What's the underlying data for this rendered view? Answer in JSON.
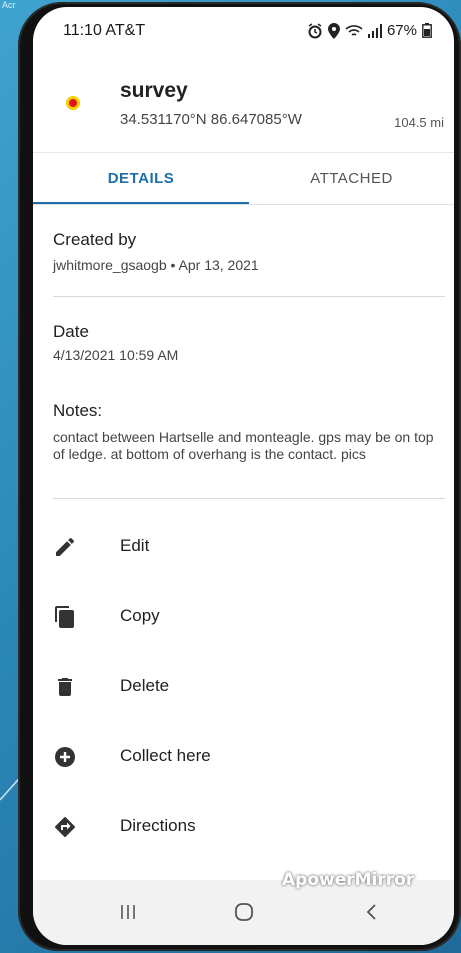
{
  "corner_text": "Acr",
  "status": {
    "time": "11:10 AT&T",
    "battery": "67%"
  },
  "feature": {
    "title": "survey",
    "coords": "34.531170°N  86.647085°W",
    "distance": "104.5 mi",
    "pin_color": "#e0141b"
  },
  "tabs": [
    {
      "label": "DETAILS",
      "active": true
    },
    {
      "label": "ATTACHED",
      "active": false
    }
  ],
  "accent": "#1e6fa8",
  "fields": {
    "created_by_label": "Created by",
    "created_by_value": "jwhitmore_gsaogb • Apr 13, 2021",
    "date_label": "Date",
    "date_value": "4/13/2021 10:59 AM",
    "notes_label": "Notes:",
    "notes_value": "contact between Hartselle and monteagle. gps may be on top of ledge. at bottom of overhang is the contact. pics"
  },
  "actions": [
    {
      "label": "Edit",
      "icon": "pencil-icon"
    },
    {
      "label": "Copy",
      "icon": "copy-icon"
    },
    {
      "label": "Delete",
      "icon": "trash-icon"
    },
    {
      "label": "Collect here",
      "icon": "plus-circle-icon"
    },
    {
      "label": "Directions",
      "icon": "directions-icon"
    }
  ],
  "watermark": "ApowerMirror",
  "navbar": [
    "recent-apps-icon",
    "home-icon",
    "back-icon"
  ]
}
